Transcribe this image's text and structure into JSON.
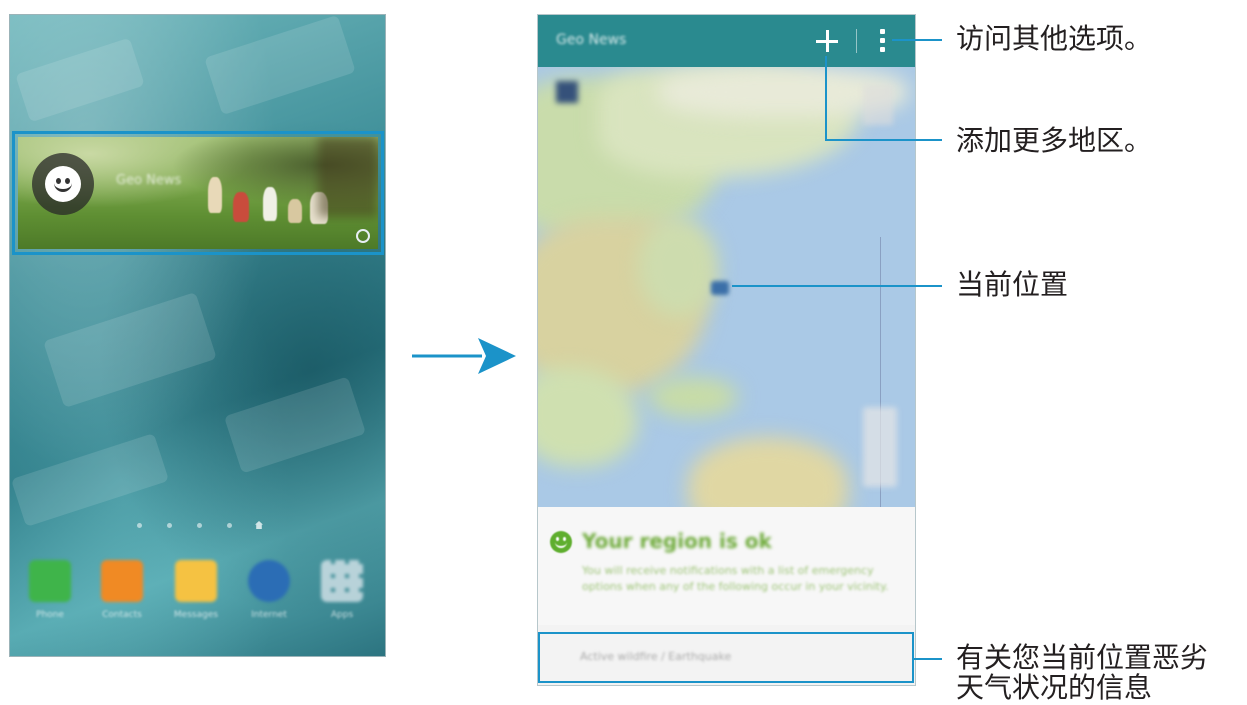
{
  "left_phone": {
    "widget": {
      "title": "Geo News"
    },
    "dock": [
      {
        "label": "Phone",
        "icon": "phone-icon",
        "color": "#3fb44a"
      },
      {
        "label": "Contacts",
        "icon": "contacts-icon",
        "color": "#f08a24"
      },
      {
        "label": "Messages",
        "icon": "messages-icon",
        "color": "#f5c242"
      },
      {
        "label": "Internet",
        "icon": "internet-icon",
        "color": "#2b6db5"
      },
      {
        "label": "Apps",
        "icon": "apps-icon",
        "color": "#d6e4ea"
      }
    ]
  },
  "right_phone": {
    "app_bar": {
      "title": "Geo News",
      "color": "#2a8a8f"
    },
    "status": {
      "title": "Your region is ok",
      "body": "You will receive notifications with a list of emergency options when any of the following occur in your vicinity."
    },
    "alert_item": "Active wildfire / Earthquake"
  },
  "callouts": {
    "more_options": "访问其他选项。",
    "add_regions": "添加更多地区。",
    "current_location": "当前位置",
    "severe_weather_line1": "有关您当前位置恶劣",
    "severe_weather_line2": "天气状况的信息"
  },
  "colors": {
    "highlight": "#1b93c9"
  }
}
